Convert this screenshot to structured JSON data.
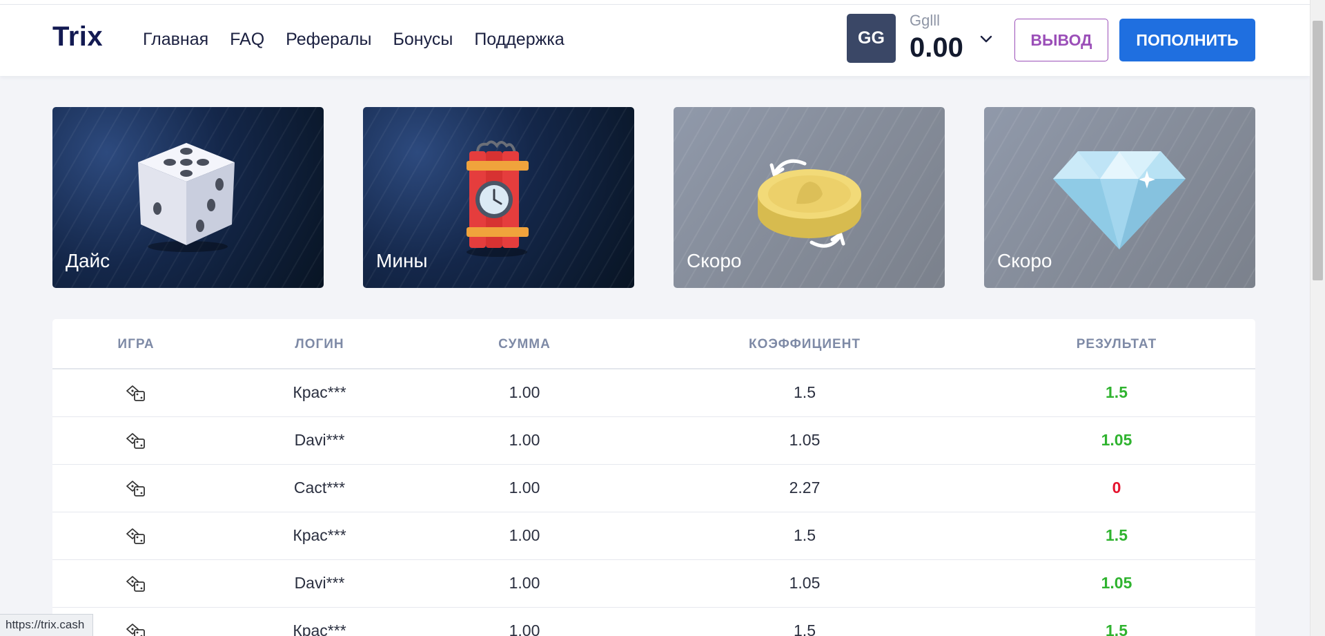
{
  "header": {
    "logo": "Trix",
    "nav": [
      "Главная",
      "FAQ",
      "Рефералы",
      "Бонусы",
      "Поддержка"
    ],
    "avatar_initials": "GG",
    "username": "Gglll",
    "balance": "0.00",
    "withdraw_label": "ВЫВОД",
    "deposit_label": "ПОПОЛНИТЬ"
  },
  "games": [
    {
      "label": "Дайс",
      "icon": "dice-icon",
      "state": "active"
    },
    {
      "label": "Мины",
      "icon": "dynamite-icon",
      "state": "active"
    },
    {
      "label": "Скоро",
      "icon": "coin-flip-icon",
      "state": "soon"
    },
    {
      "label": "Скоро",
      "icon": "diamond-icon",
      "state": "soon"
    }
  ],
  "table": {
    "headers": [
      "ИГРА",
      "ЛОГИН",
      "СУММА",
      "КОЭФФИЦИЕНТ",
      "РЕЗУЛЬТАТ"
    ],
    "rows": [
      {
        "game_icon": "dice-icon",
        "login": "Крас***",
        "amount": "1.00",
        "coef": "1.5",
        "result": "1.5",
        "win": true
      },
      {
        "game_icon": "dice-icon",
        "login": "Davi***",
        "amount": "1.00",
        "coef": "1.05",
        "result": "1.05",
        "win": true
      },
      {
        "game_icon": "dice-icon",
        "login": "Cact***",
        "amount": "1.00",
        "coef": "2.27",
        "result": "0",
        "win": false
      },
      {
        "game_icon": "dice-icon",
        "login": "Крас***",
        "amount": "1.00",
        "coef": "1.5",
        "result": "1.5",
        "win": true
      },
      {
        "game_icon": "dice-icon",
        "login": "Davi***",
        "amount": "1.00",
        "coef": "1.05",
        "result": "1.05",
        "win": true
      },
      {
        "game_icon": "dice-icon",
        "login": "Крас***",
        "amount": "1.00",
        "coef": "1.5",
        "result": "1.5",
        "win": true
      }
    ]
  },
  "colors": {
    "win": "#2fb32f",
    "loss": "#e5132e",
    "accent": "#1f6fe0",
    "withdraw": "#9b4fb8"
  },
  "status_url": "https://trix.cash"
}
